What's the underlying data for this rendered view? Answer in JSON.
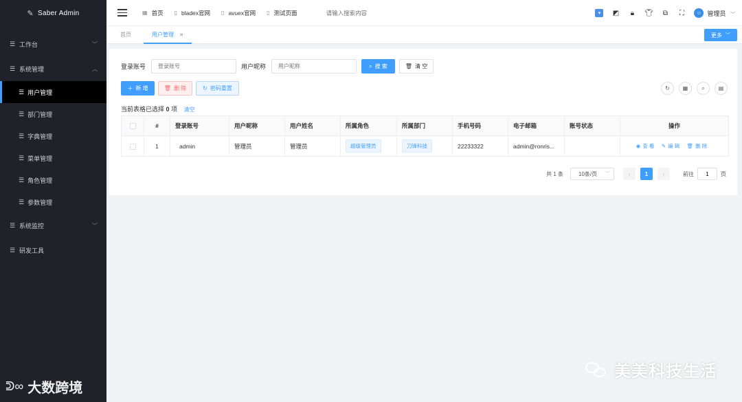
{
  "app": {
    "logo_text": "Saber Admin"
  },
  "sidebar": {
    "items": [
      {
        "label": "工作台"
      },
      {
        "label": "系统管理"
      },
      {
        "label": "系统监控"
      },
      {
        "label": "研发工具"
      }
    ],
    "sub_items": [
      {
        "label": "用户管理"
      },
      {
        "label": "部门管理"
      },
      {
        "label": "字典管理"
      },
      {
        "label": "菜单管理"
      },
      {
        "label": "角色管理"
      },
      {
        "label": "参数管理"
      }
    ]
  },
  "topbar": {
    "links": [
      {
        "label": "首页",
        "icon": "grid-icon"
      },
      {
        "label": "bladex官网",
        "icon": "document-icon"
      },
      {
        "label": "avuex官网",
        "icon": "document-icon"
      },
      {
        "label": "测试页面",
        "icon": "document-icon"
      }
    ],
    "search_placeholder": "请输入搜索内容",
    "username": "管理员"
  },
  "tabs": {
    "home": "首页",
    "active": "用户管理",
    "more": "更多"
  },
  "search": {
    "account_label": "登录账号",
    "account_placeholder": "登录账号",
    "nickname_label": "用户昵称",
    "nickname_placeholder": "用户昵称",
    "search_button": "搜 索",
    "clear_button": "清 空"
  },
  "actions": {
    "add": "新 增",
    "delete": "删 除",
    "reset_password": "密码重置"
  },
  "selection": {
    "prefix": "当前表格已选择",
    "count": "0",
    "suffix": "项",
    "clear": "清空"
  },
  "table": {
    "headers": [
      "#",
      "登录账号",
      "用户昵称",
      "用户姓名",
      "所属角色",
      "所属部门",
      "手机号码",
      "电子邮箱",
      "账号状态",
      "操作"
    ],
    "rows": [
      {
        "index": "1",
        "account": "admin",
        "nickname": "管理员",
        "name": "管理员",
        "role": "超级管理员",
        "dept": "刀锋科技",
        "phone": "22233322",
        "email": "admin@ronris...",
        "status": "",
        "ops": {
          "view": "查 看",
          "edit": "编 辑",
          "delete": "删 除"
        }
      }
    ]
  },
  "pagination": {
    "total": "共 1 条",
    "page_size": "10条/页",
    "current": "1",
    "goto_label": "前往",
    "goto_value": "1",
    "page_suffix": "页"
  },
  "watermarks": {
    "left": "大数跨境",
    "right": "美美科技生活"
  },
  "colors": {
    "primary": "#409eff",
    "sidebar_bg": "#20222a",
    "danger": "#f56c6c"
  }
}
